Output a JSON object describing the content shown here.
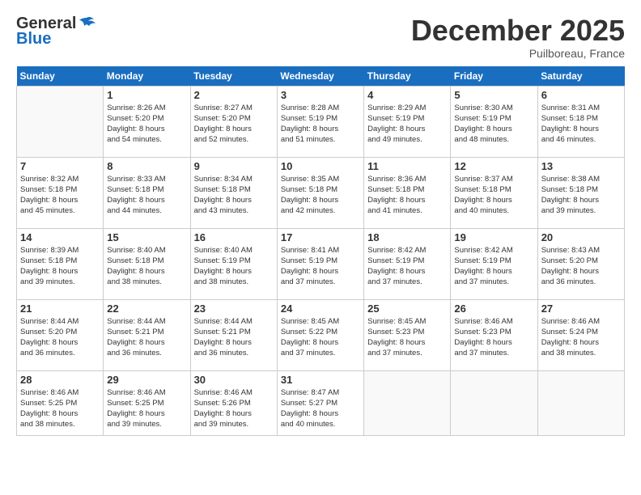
{
  "header": {
    "logo_general": "General",
    "logo_blue": "Blue",
    "month": "December 2025",
    "location": "Puilboreau, France"
  },
  "days_of_week": [
    "Sunday",
    "Monday",
    "Tuesday",
    "Wednesday",
    "Thursday",
    "Friday",
    "Saturday"
  ],
  "weeks": [
    [
      {
        "day": "",
        "info": ""
      },
      {
        "day": "1",
        "info": "Sunrise: 8:26 AM\nSunset: 5:20 PM\nDaylight: 8 hours\nand 54 minutes."
      },
      {
        "day": "2",
        "info": "Sunrise: 8:27 AM\nSunset: 5:20 PM\nDaylight: 8 hours\nand 52 minutes."
      },
      {
        "day": "3",
        "info": "Sunrise: 8:28 AM\nSunset: 5:19 PM\nDaylight: 8 hours\nand 51 minutes."
      },
      {
        "day": "4",
        "info": "Sunrise: 8:29 AM\nSunset: 5:19 PM\nDaylight: 8 hours\nand 49 minutes."
      },
      {
        "day": "5",
        "info": "Sunrise: 8:30 AM\nSunset: 5:19 PM\nDaylight: 8 hours\nand 48 minutes."
      },
      {
        "day": "6",
        "info": "Sunrise: 8:31 AM\nSunset: 5:18 PM\nDaylight: 8 hours\nand 46 minutes."
      }
    ],
    [
      {
        "day": "7",
        "info": "Sunrise: 8:32 AM\nSunset: 5:18 PM\nDaylight: 8 hours\nand 45 minutes."
      },
      {
        "day": "8",
        "info": "Sunrise: 8:33 AM\nSunset: 5:18 PM\nDaylight: 8 hours\nand 44 minutes."
      },
      {
        "day": "9",
        "info": "Sunrise: 8:34 AM\nSunset: 5:18 PM\nDaylight: 8 hours\nand 43 minutes."
      },
      {
        "day": "10",
        "info": "Sunrise: 8:35 AM\nSunset: 5:18 PM\nDaylight: 8 hours\nand 42 minutes."
      },
      {
        "day": "11",
        "info": "Sunrise: 8:36 AM\nSunset: 5:18 PM\nDaylight: 8 hours\nand 41 minutes."
      },
      {
        "day": "12",
        "info": "Sunrise: 8:37 AM\nSunset: 5:18 PM\nDaylight: 8 hours\nand 40 minutes."
      },
      {
        "day": "13",
        "info": "Sunrise: 8:38 AM\nSunset: 5:18 PM\nDaylight: 8 hours\nand 39 minutes."
      }
    ],
    [
      {
        "day": "14",
        "info": "Sunrise: 8:39 AM\nSunset: 5:18 PM\nDaylight: 8 hours\nand 39 minutes."
      },
      {
        "day": "15",
        "info": "Sunrise: 8:40 AM\nSunset: 5:18 PM\nDaylight: 8 hours\nand 38 minutes."
      },
      {
        "day": "16",
        "info": "Sunrise: 8:40 AM\nSunset: 5:19 PM\nDaylight: 8 hours\nand 38 minutes."
      },
      {
        "day": "17",
        "info": "Sunrise: 8:41 AM\nSunset: 5:19 PM\nDaylight: 8 hours\nand 37 minutes."
      },
      {
        "day": "18",
        "info": "Sunrise: 8:42 AM\nSunset: 5:19 PM\nDaylight: 8 hours\nand 37 minutes."
      },
      {
        "day": "19",
        "info": "Sunrise: 8:42 AM\nSunset: 5:19 PM\nDaylight: 8 hours\nand 37 minutes."
      },
      {
        "day": "20",
        "info": "Sunrise: 8:43 AM\nSunset: 5:20 PM\nDaylight: 8 hours\nand 36 minutes."
      }
    ],
    [
      {
        "day": "21",
        "info": "Sunrise: 8:44 AM\nSunset: 5:20 PM\nDaylight: 8 hours\nand 36 minutes."
      },
      {
        "day": "22",
        "info": "Sunrise: 8:44 AM\nSunset: 5:21 PM\nDaylight: 8 hours\nand 36 minutes."
      },
      {
        "day": "23",
        "info": "Sunrise: 8:44 AM\nSunset: 5:21 PM\nDaylight: 8 hours\nand 36 minutes."
      },
      {
        "day": "24",
        "info": "Sunrise: 8:45 AM\nSunset: 5:22 PM\nDaylight: 8 hours\nand 37 minutes."
      },
      {
        "day": "25",
        "info": "Sunrise: 8:45 AM\nSunset: 5:23 PM\nDaylight: 8 hours\nand 37 minutes."
      },
      {
        "day": "26",
        "info": "Sunrise: 8:46 AM\nSunset: 5:23 PM\nDaylight: 8 hours\nand 37 minutes."
      },
      {
        "day": "27",
        "info": "Sunrise: 8:46 AM\nSunset: 5:24 PM\nDaylight: 8 hours\nand 38 minutes."
      }
    ],
    [
      {
        "day": "28",
        "info": "Sunrise: 8:46 AM\nSunset: 5:25 PM\nDaylight: 8 hours\nand 38 minutes."
      },
      {
        "day": "29",
        "info": "Sunrise: 8:46 AM\nSunset: 5:25 PM\nDaylight: 8 hours\nand 39 minutes."
      },
      {
        "day": "30",
        "info": "Sunrise: 8:46 AM\nSunset: 5:26 PM\nDaylight: 8 hours\nand 39 minutes."
      },
      {
        "day": "31",
        "info": "Sunrise: 8:47 AM\nSunset: 5:27 PM\nDaylight: 8 hours\nand 40 minutes."
      },
      {
        "day": "",
        "info": ""
      },
      {
        "day": "",
        "info": ""
      },
      {
        "day": "",
        "info": ""
      }
    ]
  ]
}
